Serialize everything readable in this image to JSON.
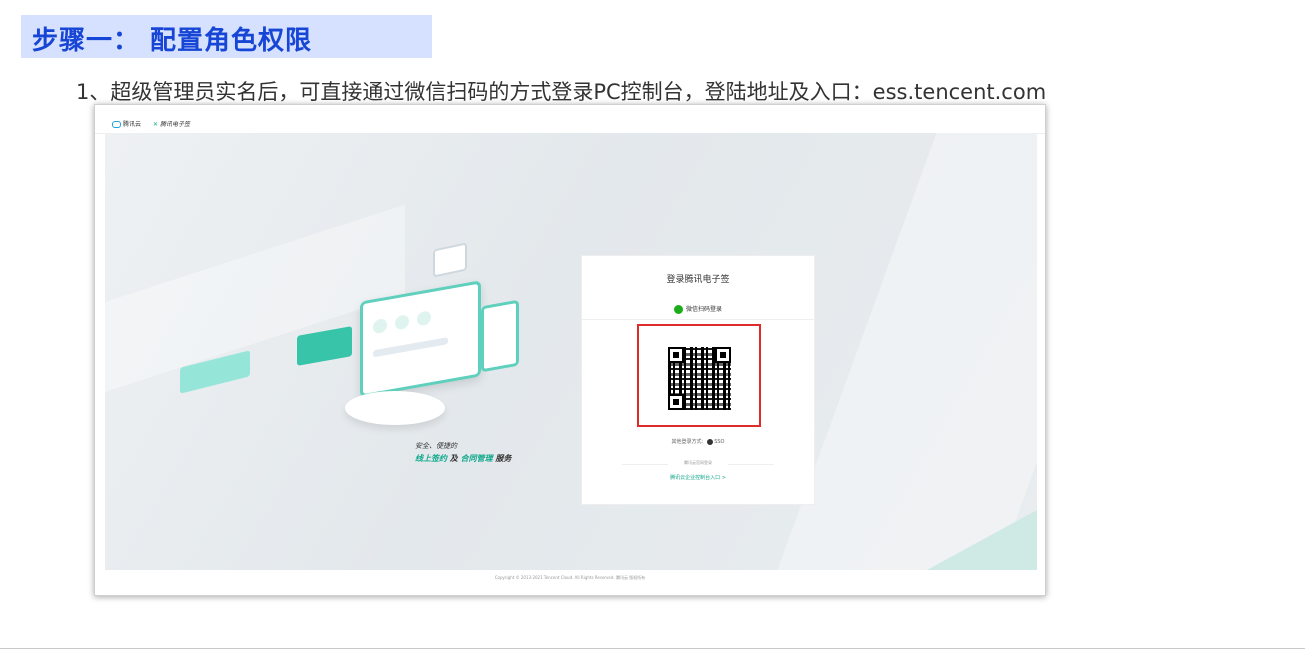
{
  "section": {
    "title": "步骤一： 配置角色权限",
    "step_text": "1、超级管理员实名后，可直接通过微信扫码的方式登录PC控制台，登陆地址及入口：ess.tencent.com"
  },
  "screenshot": {
    "header": {
      "logo_cloud": "腾讯云",
      "logo_ess": "腾讯电子签"
    },
    "slogan": {
      "line1": "安全、便捷的",
      "part1": "线上签约",
      "part2": "及",
      "part3": "合同管理",
      "part4": "服务"
    },
    "login": {
      "title": "登录腾讯电子签",
      "wechat_label": "微信扫码登录",
      "other_label": "其他登录方式:",
      "sso_label": "SSO",
      "divider_label": "腾讯云官网登录",
      "console_link": "腾讯云企业控制台入口 >"
    },
    "footer": "Copyright © 2013-2021 Tencent Cloud. All Rights Reserved. 腾讯云 版权所有",
    "colors": {
      "accent": "#10a88b",
      "highlight_border": "#e02b2b",
      "title_bg": "#d6e0ff",
      "title_text": "#1746d6"
    }
  }
}
